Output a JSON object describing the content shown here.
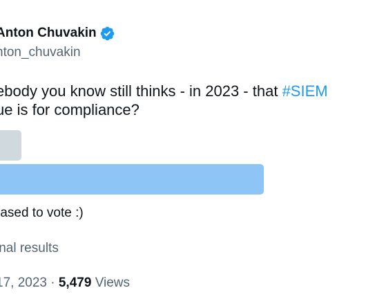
{
  "author": {
    "name": "Anton Chuvakin",
    "handle": "nton_chuvakin",
    "verified_color": "#1d9bf0"
  },
  "tweet": {
    "line1_prefix": "ebody you know still thinks - in 2023 - that ",
    "hashtag": "#SIEM",
    "line2": "ue is for compliance?"
  },
  "poll": {
    "options": [
      {
        "fill_fraction": 0.05
      },
      {
        "fill_fraction": 0.95
      }
    ],
    "note": "rased to vote :)",
    "status": "inal results"
  },
  "meta": {
    "date": "17, 2023",
    "separator": "·",
    "views_count": "5,479",
    "views_label": "Views"
  }
}
